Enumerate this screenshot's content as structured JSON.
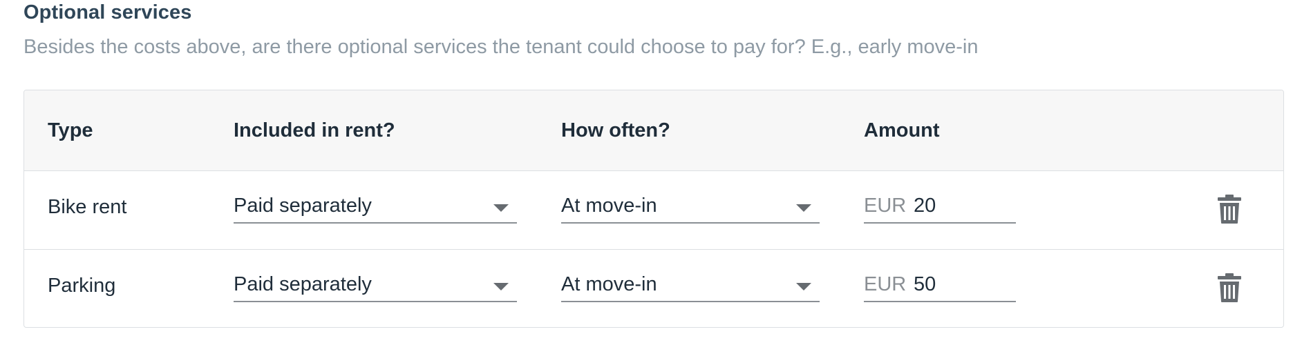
{
  "section": {
    "title": "Optional services",
    "description": "Besides the costs above, are there optional services the tenant could choose to pay for? E.g., early move-in"
  },
  "table": {
    "columns": {
      "type": "Type",
      "included": "Included in rent?",
      "how_often": "How often?",
      "amount": "Amount"
    },
    "rows": [
      {
        "type": "Bike rent",
        "included": "Paid separately",
        "how_often": "At move-in",
        "currency": "EUR",
        "amount": "20"
      },
      {
        "type": "Parking",
        "included": "Paid separately",
        "how_often": "At move-in",
        "currency": "EUR",
        "amount": "50"
      }
    ]
  },
  "icons": {
    "dropdown": "chevron-down-icon",
    "delete": "trash-icon"
  },
  "colors": {
    "title": "#2f4658",
    "description": "#8e9aa4",
    "header_bg": "#f7f7f7",
    "border": "#dcdfe2",
    "icon": "#666b70"
  }
}
